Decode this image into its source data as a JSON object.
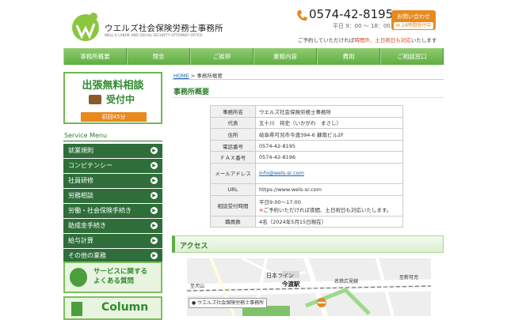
{
  "header": {
    "logo_name": "ウエルズ社会保険労務士事務所",
    "logo_en": "WELL'S LABOR AND SOCIAL SECURITY ATTORNEY OFFICE",
    "phone": "0574-42-8195",
    "hours": "平日 9：00 ～ 18：00",
    "contact_line1": "お問い合わせ",
    "contact_line2": "24時間受付中",
    "tagline_pre": "ご予約していただければ",
    "tagline_hl": "時間外、土日祝日も対応",
    "tagline_post": "いたします"
  },
  "nav": {
    "items": [
      "事務所概要",
      "理念",
      "ご挨拶",
      "業務内容",
      "費用",
      "ご相談窓口"
    ]
  },
  "sidebar": {
    "banner_title": "出張無料相談",
    "banner_sub": "受付中",
    "banner_note": "初回45分",
    "service_menu_title": "Service Menu",
    "menu": [
      "就業規則",
      "コンピテンシー",
      "社員研修",
      "労務相談",
      "労働・社会保険手続き",
      "助成金手続き",
      "給与計算",
      "その他の業務"
    ],
    "faq_line1": "サービスに関する",
    "faq_line2": "よくある質問",
    "column_label": "Column"
  },
  "main": {
    "breadcrumb_home": "HOME",
    "breadcrumb_sep": ">",
    "breadcrumb_current": "事務所概要",
    "heading": "事務所概要",
    "access_heading": "アクセス",
    "info": {
      "office_label": "事務所名",
      "office_value": "ウエルズ社会保険労務士事務所",
      "rep_label": "代表",
      "rep_value": "五十川　将史（いかがわ　まさし）",
      "addr_label": "住所",
      "addr_value": "岐阜県可児市今渡394-6 蘇南ビル2F",
      "tel_label": "電話番号",
      "tel_value": "0574-42-8195",
      "fax_label": "ＦＡＸ番号",
      "fax_value": "0574-42-8196",
      "mail_label": "メールアドレス",
      "mail_value": "info@wels-sr.com",
      "url_label": "URL",
      "url_value": "https://www.wels-sr.com",
      "hours_label": "相談受付時間",
      "hours_value1": "平日9:00～17:00",
      "hours_mark": "※",
      "hours_value2": "ご予約いただければ夜間、土日祝日も対応いたします。",
      "staff_label": "職員数",
      "staff_value": "4名（2024年5月15日現在）"
    },
    "map": {
      "line_label": "日本ライン",
      "station_label": "今渡駅",
      "place1": "名鉄広見線",
      "place2": "至犬山",
      "place3": "至新可児",
      "office_label": "ウエルズ社会保険労務士事務所"
    }
  },
  "colors": {
    "brand_green": "#5fae42",
    "menu_green": "#2f6e3a",
    "accent_orange": "#e8891e",
    "link_blue": "#1a5fb4"
  }
}
